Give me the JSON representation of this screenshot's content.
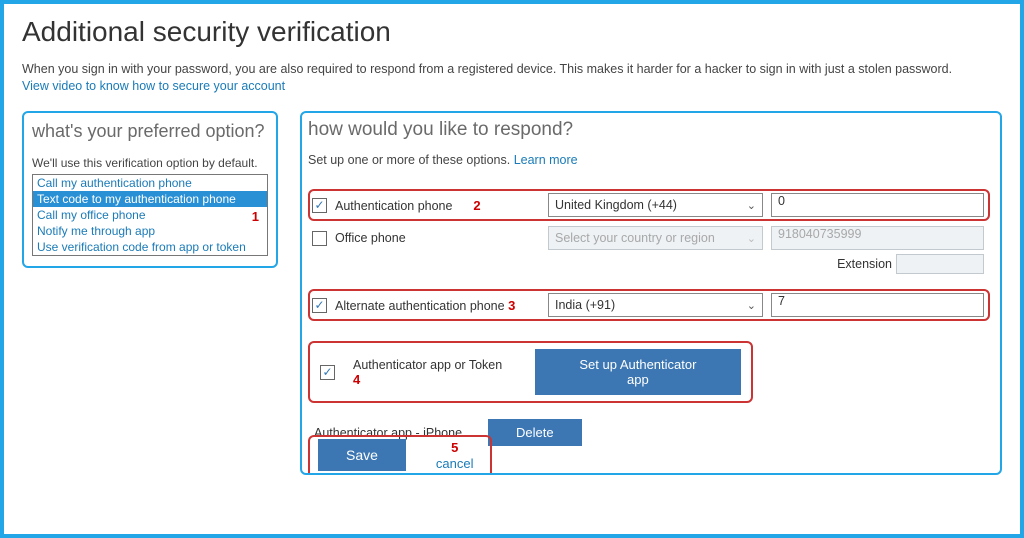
{
  "page_title": "Additional security verification",
  "intro_text": "When you sign in with your password, you are also required to respond from a registered device. This makes it harder for a hacker to sign in with just a stolen password.",
  "video_link": "View video to know how to secure your account",
  "preferred": {
    "heading": "what's your preferred option?",
    "sub": "We'll use this verification option by default.",
    "options": [
      "Call my authentication phone",
      "Text code to my authentication phone",
      "Call my office phone",
      "Notify me through app",
      "Use verification code from app or token"
    ],
    "selected_index": 1,
    "annotation": "1"
  },
  "respond": {
    "heading": "how would you like to respond?",
    "sub_prefix": "Set up one or more of these options. ",
    "learn_more": "Learn more",
    "rows": {
      "auth_phone": {
        "checked": true,
        "label": "Authentication phone",
        "annotation": "2",
        "country": "United Kingdom (+44)",
        "number": "0"
      },
      "office_phone": {
        "checked": false,
        "label": "Office phone",
        "country_placeholder": "Select your country or region",
        "number": "918040735999",
        "extension_label": "Extension"
      },
      "alt_phone": {
        "checked": true,
        "label": "Alternate authentication phone",
        "annotation": "3",
        "country": "India (+91)",
        "number": "7"
      },
      "auth_app": {
        "checked": true,
        "label": "Authenticator app or Token",
        "annotation": "4",
        "button": "Set up Authenticator app"
      },
      "device": {
        "label": "Authenticator app - iPhone",
        "delete": "Delete"
      }
    },
    "actions": {
      "save": "Save",
      "cancel": "cancel",
      "annotation": "5"
    }
  }
}
